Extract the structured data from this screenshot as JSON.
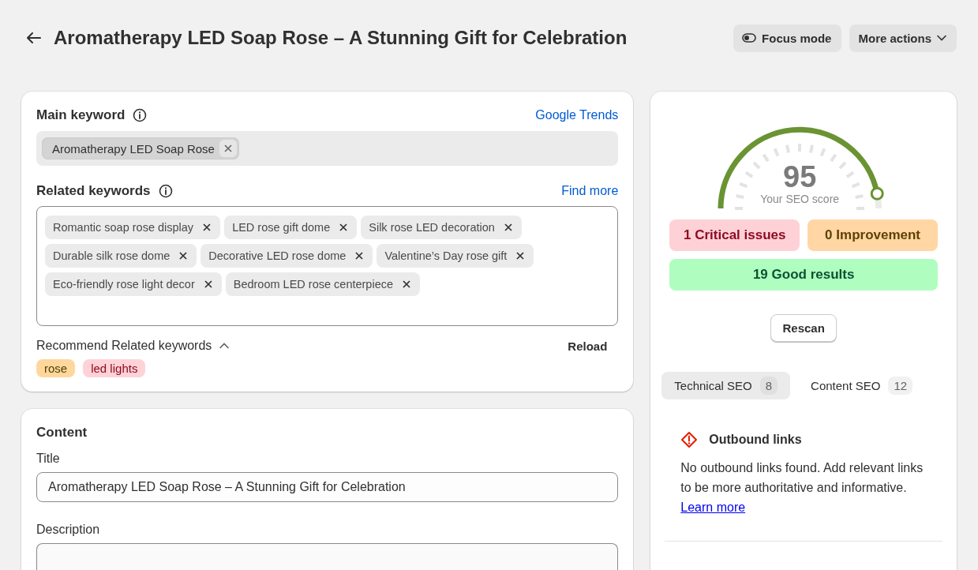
{
  "header": {
    "title": "Aromatherapy LED Soap Rose – A Stunning Gift for Celebration",
    "actions": [
      {
        "kind": "toggle",
        "label": "Focus mode"
      },
      {
        "kind": "menu",
        "label": "More actions"
      }
    ]
  },
  "keywords": {
    "main_label": "Main keyword",
    "main_link": "Google Trends",
    "main_tags": [
      "Aromatherapy LED Soap Rose"
    ],
    "related_label": "Related keywords",
    "related_link": "Find more",
    "related_tags": [
      "Romantic soap rose display",
      "LED rose gift dome",
      "Silk rose LED decoration",
      "Durable silk rose dome",
      "Decorative LED rose dome",
      "Valentine’s Day rose gift",
      "Eco-friendly rose light decor",
      "Bedroom LED rose centerpiece"
    ],
    "recommend_label": "Recommend Related keywords",
    "recommend_expanded": true,
    "reload": "Reload",
    "recommend_tags": [
      {
        "label": "rose",
        "color": "#ffd79d"
      },
      {
        "label": "led lights",
        "color": "#fed3d7"
      }
    ]
  },
  "content": {
    "heading": "Content",
    "title_label": "Title",
    "title_value": "Aromatherapy LED Soap Rose – A Stunning Gift for Celebration",
    "description_label": "Description"
  },
  "score": {
    "value": "95",
    "caption": "Your SEO score",
    "level": 0.94,
    "results": [
      {
        "label": "1 Critical issues",
        "color": "#fed1d7"
      },
      {
        "label": "0 Improvement",
        "color": "#ffd6a4"
      },
      {
        "label": "19 Good results",
        "color": "#affebf"
      }
    ],
    "rescan": "Rescan",
    "tabs": [
      {
        "label": "Technical SEO",
        "count": "8",
        "selected": true
      },
      {
        "label": "Content SEO",
        "count": "12",
        "selected": false
      }
    ],
    "issue": {
      "title": "Outbound links",
      "text": "No outbound links found. Add relevant links to be more authoritative and informative.",
      "link": "Learn more"
    }
  }
}
